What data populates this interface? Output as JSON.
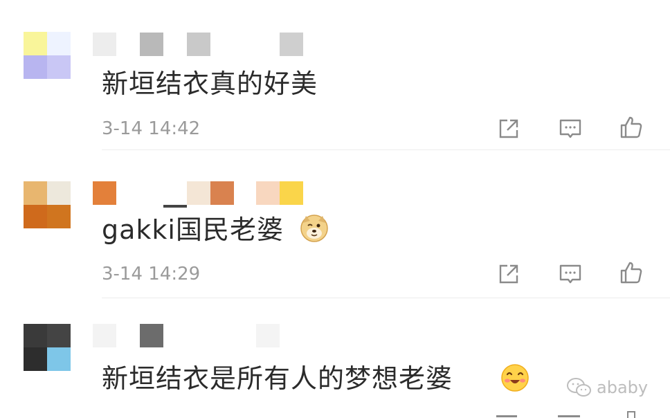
{
  "comments": [
    {
      "text": "新垣结衣真的好美",
      "time": "3-14 14:42",
      "avatar_colors": [
        "#f9f59a",
        "#eef3ff",
        "#b8b5f0",
        "#c9c7f5"
      ]
    },
    {
      "text": "gakki国民老婆",
      "time": "3-14 14:29",
      "avatar_colors": [
        "#e8b66f",
        "#ede8dc",
        "#cf6a1c",
        "#d0751f"
      ]
    },
    {
      "text": "新垣结衣是所有人的梦想老婆",
      "time": "",
      "avatar_colors": [
        "#3a3a3a",
        "#444444",
        "#2d2d2d",
        "#7ec6e8"
      ]
    }
  ],
  "icons": {
    "share": "share-icon",
    "reply": "comment-icon",
    "like": "thumbs-up-icon"
  },
  "watermark": {
    "text": "ababy"
  },
  "colors": {
    "text": "#2b2b2b",
    "time": "#9a9a9a",
    "icon": "#8a8a8a"
  }
}
